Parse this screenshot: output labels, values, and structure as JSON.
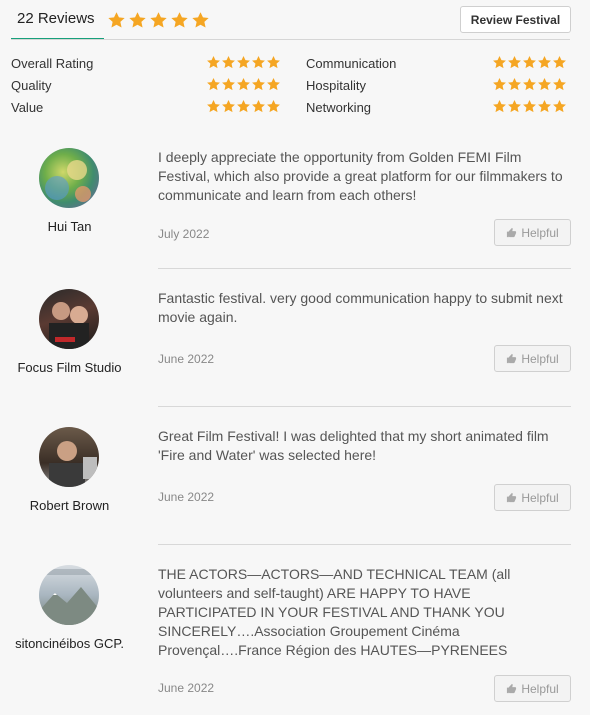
{
  "header": {
    "reviews_tab": "22 Reviews",
    "review_button": "Review Festival",
    "overall_stars": 5,
    "star_color": "#f5a623"
  },
  "ratings": [
    {
      "label": "Overall Rating",
      "stars": 5
    },
    {
      "label": "Quality",
      "stars": 5
    },
    {
      "label": "Value",
      "stars": 5
    },
    {
      "label": "Communication",
      "stars": 5
    },
    {
      "label": "Hospitality",
      "stars": 5
    },
    {
      "label": "Networking",
      "stars": 5
    }
  ],
  "reviews": [
    {
      "name": "Hui Tan",
      "text": "I deeply appreciate the opportunity from Golden FEMI Film Festival, which also provide a great platform for our filmmakers to communicate and learn from each others!",
      "date": "July 2022",
      "helpful": "Helpful"
    },
    {
      "name": "Focus Film Studio",
      "text": "Fantastic festival. very good communication happy to submit next movie again.",
      "date": "June 2022",
      "helpful": "Helpful"
    },
    {
      "name": "Robert Brown",
      "text": "Great Film Festival! I was delighted that my short animated film 'Fire and Water' was selected here!",
      "date": "June 2022",
      "helpful": "Helpful"
    },
    {
      "name": "sitoncinéibos GCP.",
      "text": "THE ACTORS—ACTORS—AND TECHNICAL TEAM (all volunteers and self-taught) ARE HAPPY TO HAVE PARTICIPATED IN YOUR FESTIVAL AND THANK YOU SINCERELY….Association Groupement Cinéma Provençal….France Région des HAUTES—PYRENEES",
      "date": "June 2022",
      "helpful": "Helpful"
    }
  ]
}
